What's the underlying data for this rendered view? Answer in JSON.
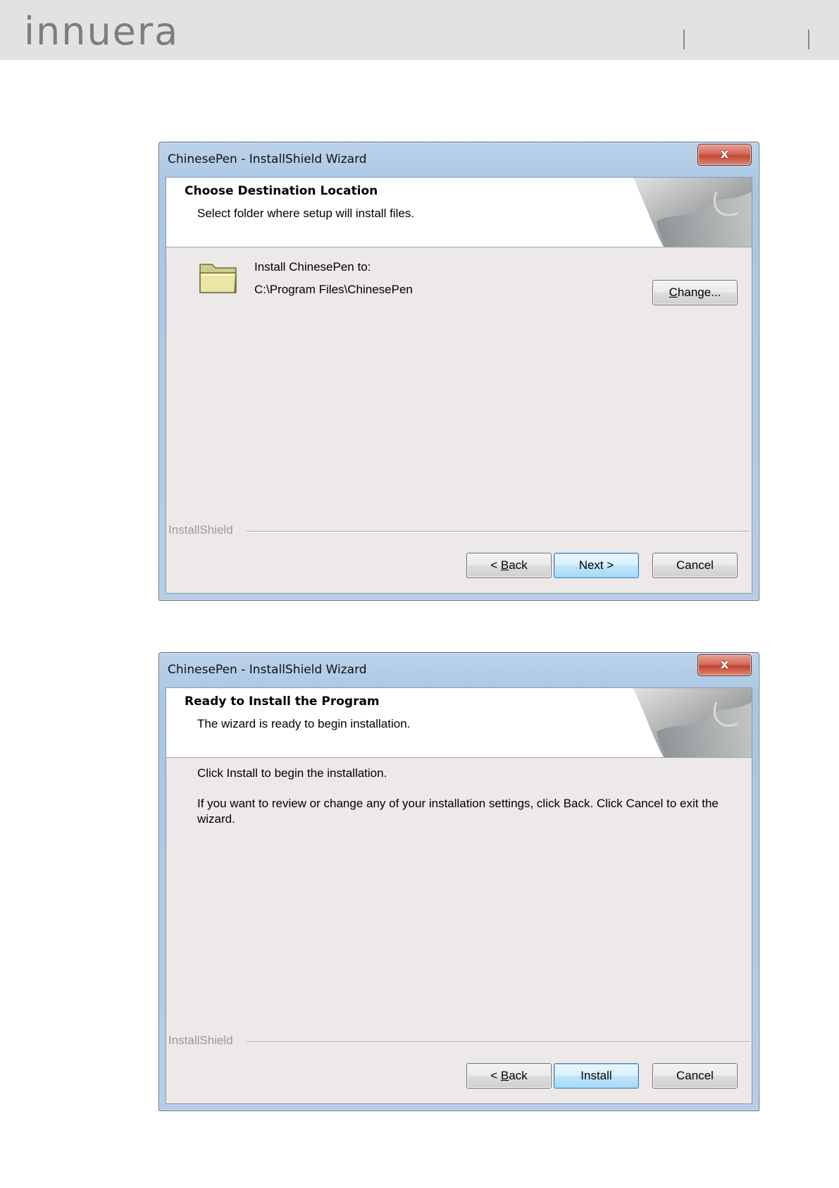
{
  "header": {
    "logo_text": "innuera"
  },
  "dialogs": [
    {
      "title": "ChinesePen - InstallShield Wizard",
      "close_label": "x",
      "banner": {
        "title": "Choose Destination Location",
        "subtitle": "Select folder where setup will install files."
      },
      "body": {
        "install_label": "Install ChinesePen to:",
        "install_path": "C:\\Program Files\\ChinesePen"
      },
      "change_button": {
        "mnemonic": "C",
        "rest": "hange..."
      },
      "brand_label": "InstallShield",
      "buttons": {
        "back": {
          "prefix": "< ",
          "mnemonic": "B",
          "rest": "ack"
        },
        "next": "Next >",
        "cancel": "Cancel"
      }
    },
    {
      "title": "ChinesePen - InstallShield Wizard",
      "close_label": "x",
      "banner": {
        "title": "Ready to Install the Program",
        "subtitle": "The wizard is ready to begin installation."
      },
      "body": {
        "line1": "Click Install to begin the installation.",
        "line2": "If you want to review or change any of your installation settings, click Back. Click Cancel to exit the wizard."
      },
      "brand_label": "InstallShield",
      "buttons": {
        "back": {
          "prefix": "< ",
          "mnemonic": "B",
          "rest": "ack"
        },
        "install": "Install",
        "cancel": "Cancel"
      }
    }
  ]
}
